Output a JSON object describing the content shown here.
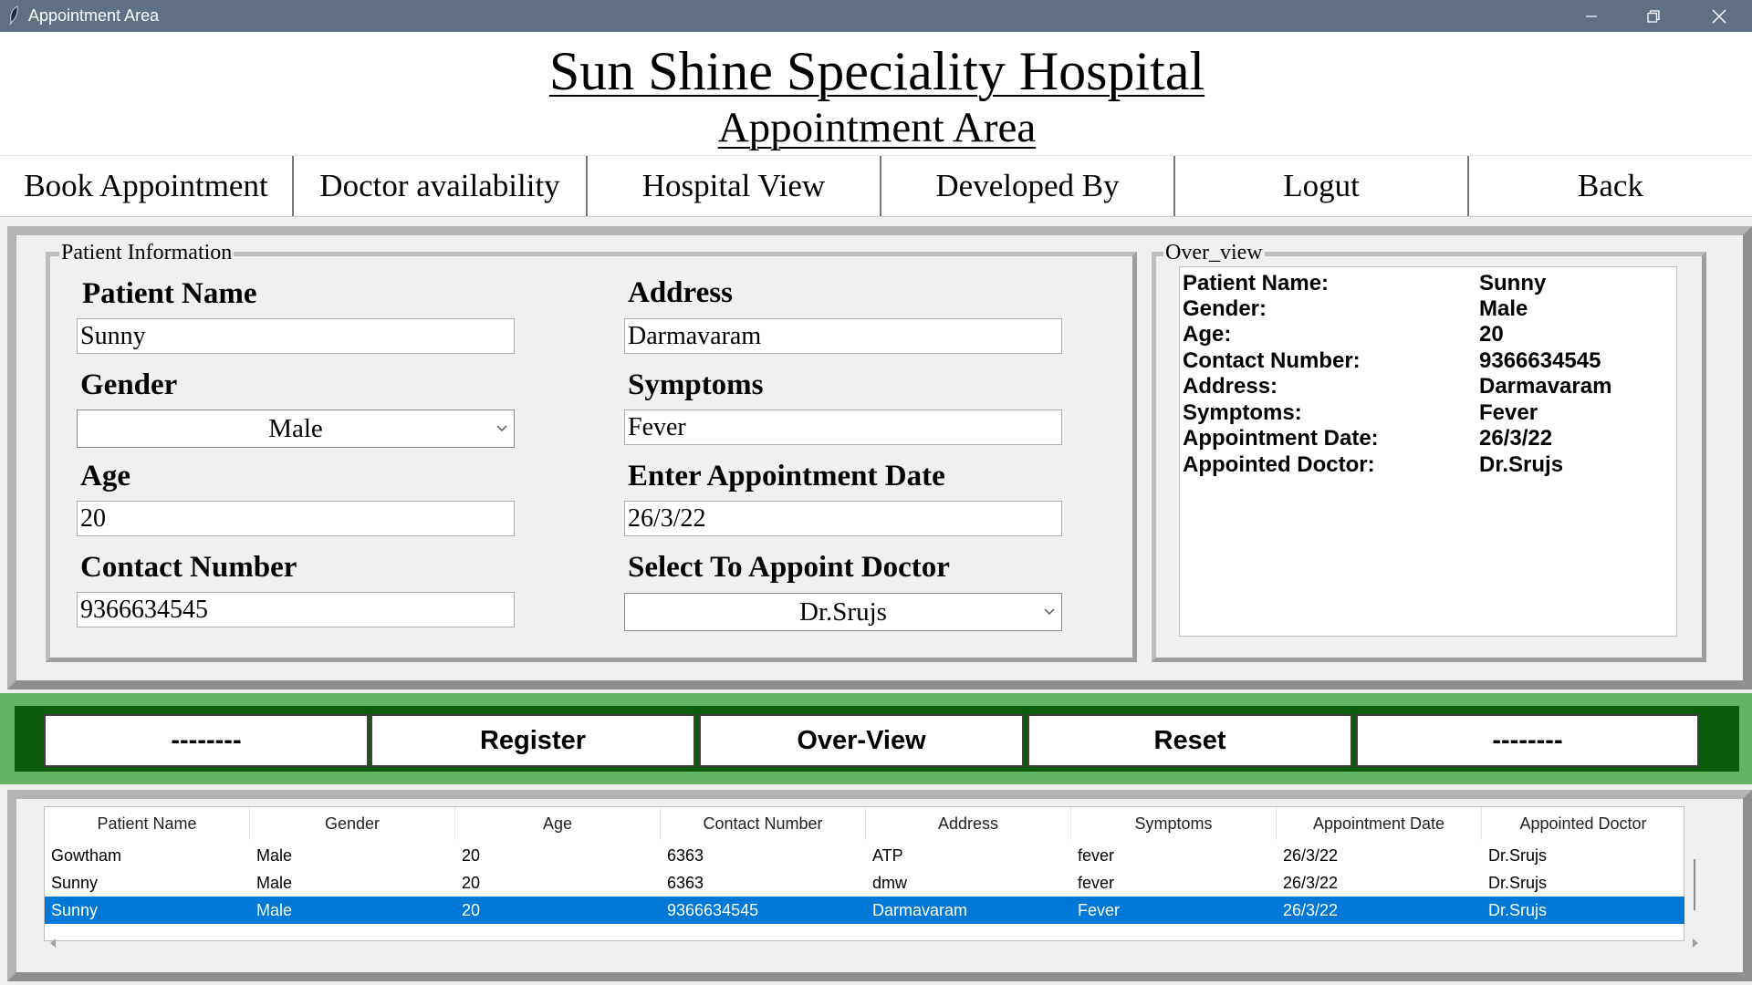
{
  "window": {
    "title": "Appointment Area",
    "controls": [
      "minimize-icon",
      "restore-icon",
      "close-icon"
    ]
  },
  "header": {
    "hospital_name": "Sun Shine Speciality Hospital",
    "area_title": "Appointment Area"
  },
  "nav": {
    "items": [
      "Book Appointment",
      "Doctor availability",
      "Hospital View",
      "Developed By",
      "Logut",
      "Back"
    ]
  },
  "patient_info": {
    "group_label": "Patient Information",
    "fields": {
      "patient_name": {
        "label": "Patient Name",
        "value": "Sunny"
      },
      "gender": {
        "label": "Gender",
        "value": "Male"
      },
      "age": {
        "label": "Age",
        "value": "20"
      },
      "contact": {
        "label": "Contact Number",
        "value": "9366634545"
      },
      "address": {
        "label": "Address",
        "value": "Darmavaram"
      },
      "symptoms": {
        "label": "Symptoms",
        "value": "Fever"
      },
      "appointment_date": {
        "label": "Enter Appointment Date",
        "value": "26/3/22"
      },
      "doctor": {
        "label": "Select To Appoint Doctor",
        "value": "Dr.Srujs"
      }
    }
  },
  "overview": {
    "group_label": "Over_view",
    "rows": [
      {
        "key": "Patient Name:",
        "value": "Sunny"
      },
      {
        "key": "Gender:",
        "value": "Male"
      },
      {
        "key": "Age:",
        "value": "20"
      },
      {
        "key": "Contact Number:",
        "value": "9366634545"
      },
      {
        "key": "Address:",
        "value": "Darmavaram"
      },
      {
        "key": "Symptoms:",
        "value": "Fever"
      },
      {
        "key": "Appointment Date:",
        "value": "26/3/22"
      },
      {
        "key": "Appointed Doctor:",
        "value": "Dr.Srujs"
      }
    ]
  },
  "actions": {
    "buttons": [
      "--------",
      "Register",
      "Over-View",
      "Reset",
      "--------"
    ]
  },
  "table": {
    "columns": [
      "Patient Name",
      "Gender",
      "Age",
      "Contact Number",
      "Address",
      "Symptoms",
      "Appointment Date",
      "Appointed Doctor"
    ],
    "rows": [
      [
        "Gowtham",
        "Male",
        "20",
        "6363",
        "ATP",
        "fever",
        "26/3/22",
        "Dr.Srujs"
      ],
      [
        "Sunny",
        "Male",
        "20",
        "6363",
        "dmw",
        "fever",
        "26/3/22",
        "Dr.Srujs"
      ],
      [
        "Sunny",
        "Male",
        "20",
        "9366634545",
        "Darmavaram",
        "Fever",
        "26/3/22",
        "Dr.Srujs"
      ]
    ],
    "selected_row": 2
  },
  "colors": {
    "titlebar": "#5f6f84",
    "green_outer": "#64b464",
    "green_inner": "#0c5c0c",
    "selection": "#0078d7"
  }
}
